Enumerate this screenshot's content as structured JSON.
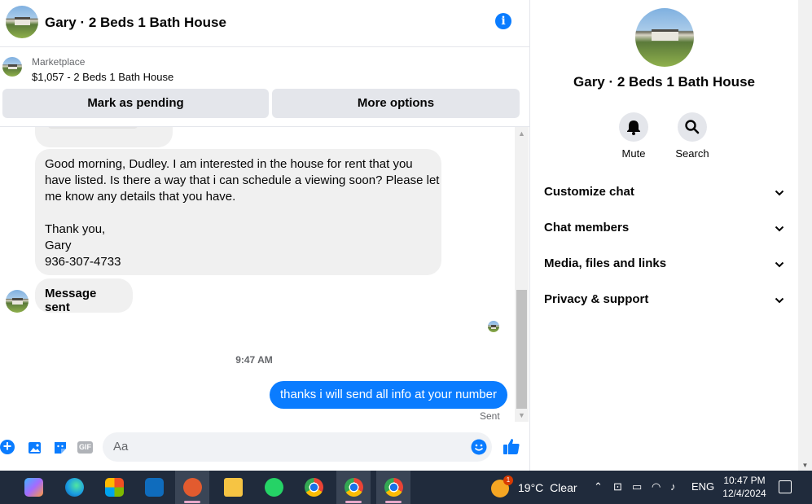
{
  "header": {
    "title": "Gary · 2 Beds 1 Bath House"
  },
  "marketplace": {
    "label": "Marketplace",
    "item": "$1,057 - 2 Beds 1 Bath House"
  },
  "actions": {
    "pending": "Mark as pending",
    "more": "More options"
  },
  "messages": {
    "incoming_lines": [
      "Good morning, Dudley.  I am interested in the house for rent that you",
      "have listed. Is there a way that i can schedule a viewing soon? Please let",
      "me know any details that you have.",
      "",
      "Thank you,",
      "Gary",
      "936-307-4733"
    ],
    "sent_notice": "Message sent",
    "timestamp": "9:47 AM",
    "outgoing": "thanks i will send all info at your number",
    "status": "Sent"
  },
  "composer": {
    "placeholder": "Aa",
    "gif": "GIF"
  },
  "panel": {
    "title": "Gary · 2 Beds 1 Bath House",
    "mute": "Mute",
    "search": "Search",
    "sections": [
      "Customize chat",
      "Chat members",
      "Media, files and links",
      "Privacy & support"
    ]
  },
  "taskbar": {
    "weather_temp": "19°C",
    "weather_cond": "Clear",
    "weather_badge": "1",
    "lang": "ENG",
    "time": "10:47 PM",
    "date": "12/4/2024"
  },
  "colors": {
    "accent": "#0a7cff",
    "taskbar": "#202b3c"
  }
}
